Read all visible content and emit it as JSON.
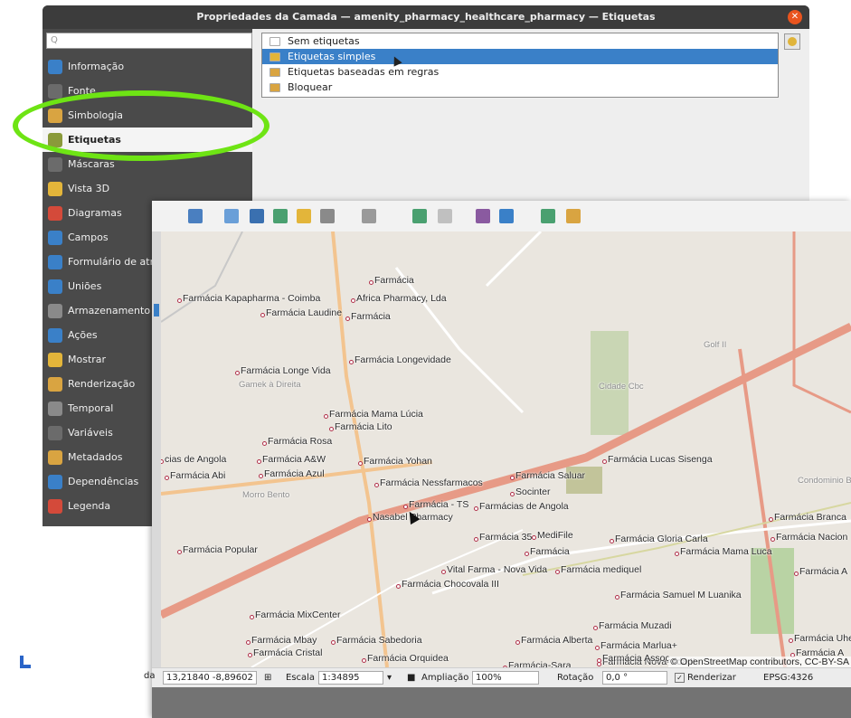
{
  "dialog": {
    "title": "Propriedades da Camada — amenity_pharmacy_healthcare_pharmacy — Etiquetas",
    "search_placeholder": "Q",
    "sidebar": [
      {
        "label": "Informação",
        "icon": "info-icon",
        "color": "#3a80c8"
      },
      {
        "label": "Fonte",
        "icon": "source-icon",
        "color": "#6b6b6b"
      },
      {
        "label": "Simbologia",
        "icon": "symbology-icon",
        "color": "#d9a441"
      },
      {
        "label": "Etiquetas",
        "icon": "labels-icon",
        "color": "#8a9a3a"
      },
      {
        "label": "Máscaras",
        "icon": "masks-icon",
        "color": "#6b6b6b"
      },
      {
        "label": "Vista 3D",
        "icon": "cube-icon",
        "color": "#e3b53a"
      },
      {
        "label": "Diagramas",
        "icon": "diagram-icon",
        "color": "#d44a3a"
      },
      {
        "label": "Campos",
        "icon": "fields-icon",
        "color": "#3a80c8"
      },
      {
        "label": "Formulário de atributos",
        "icon": "form-icon",
        "color": "#3a80c8"
      },
      {
        "label": "Uniões",
        "icon": "join-icon",
        "color": "#3a80c8"
      },
      {
        "label": "Armazenamento auxiliar",
        "icon": "storage-icon",
        "color": "#8a8a8a"
      },
      {
        "label": "Ações",
        "icon": "gear-icon",
        "color": "#3a80c8"
      },
      {
        "label": "Mostrar",
        "icon": "speech-icon",
        "color": "#e3b53a"
      },
      {
        "label": "Renderização",
        "icon": "brush-icon",
        "color": "#d9a441"
      },
      {
        "label": "Temporal",
        "icon": "clock-icon",
        "color": "#8a8a8a"
      },
      {
        "label": "Variáveis",
        "icon": "variables-icon",
        "color": "#6b6b6b"
      },
      {
        "label": "Metadados",
        "icon": "metadata-icon",
        "color": "#d9a441"
      },
      {
        "label": "Dependências",
        "icon": "dependencies-icon",
        "color": "#3a80c8"
      },
      {
        "label": "Legenda",
        "icon": "legend-icon",
        "color": "#d44a3a"
      }
    ],
    "active_item": "Etiquetas",
    "label_mode_options": [
      {
        "label": "Sem etiquetas",
        "color": "#ffffff"
      },
      {
        "label": "Etiquetas simples",
        "color": "#e3b53a"
      },
      {
        "label": "Etiquetas baseadas em regras",
        "color": "#d9a441"
      },
      {
        "label": "Bloquear",
        "color": "#d9a441"
      }
    ],
    "selected_option": "Etiquetas simples",
    "highlight_color": "#6ee414"
  },
  "map": {
    "labels": [
      "Farmácia Kapapharma - Coimba",
      "Farmácia",
      "Africa Pharmacy, Lda",
      "Farmácia Laudine",
      "Farmácia",
      "Farmácia Longevidade",
      "Farmácia Longe Vida",
      "Farmácia Mama Lúcia",
      "Farmácia Lito",
      "Farmácia Rosa",
      "Farmácia A&W",
      "Farmácia Azul",
      "Farmácia Yohan",
      "Farmácia Abi",
      "Farmácia Nessfarmacos",
      "Farmácia Saluar",
      "Socinter",
      "Farmácia - TS",
      "Farmácias de Angola",
      "Nasabel Pharmacy",
      "Farmácia Lucas Sisenga",
      "Farmácia 35",
      "MediFile",
      "Farmácia",
      "Farmácia Gloria Carla",
      "Farmácia Mama Luca",
      "Farmácia Nacion",
      "Farmácia Branca",
      "Farmácia Popular",
      "Vital Farma - Nova Vida",
      "Farmácia mediquel",
      "Farmácia Chocovala III",
      "Farmácia A",
      "Farmácia Samuel M Luanika",
      "Farmácia MixCenter",
      "Farmácia Muzadi",
      "Farmácia Mbay",
      "Farmácia Sabedoria",
      "Farmácia Alberta",
      "Farmácia Marlua+",
      "Farmácia Cristal",
      "Farmácia Orquidea",
      "Farmácia Nova-vida II",
      "Farmácia-Sara",
      "Farmácia Uhe",
      "Farmácia A",
      "Farmácia Assoc",
      "cias de Angola"
    ],
    "faint_labels": [
      "Gamek à Direita",
      "Golf II",
      "Cidade Cbc",
      "Morro Bento",
      "Condominio Beira"
    ],
    "attribution": "© OpenStreetMap contributors, CC-BY-SA",
    "background": "#eae6df",
    "road_color": "#e8a08a",
    "point_color": "#b0304a"
  },
  "statusbar": {
    "coord_prefix": "da",
    "coordinate": "13,21840 -8,89602",
    "scale_label": "Escala",
    "scale_value": "1:34895",
    "magnifier_label": "Ampliação",
    "magnifier_value": "100%",
    "rotation_label": "Rotação",
    "rotation_value": "0,0 °",
    "render_label": "Renderizar",
    "render_check": "✓",
    "crs": "EPSG:4326"
  }
}
